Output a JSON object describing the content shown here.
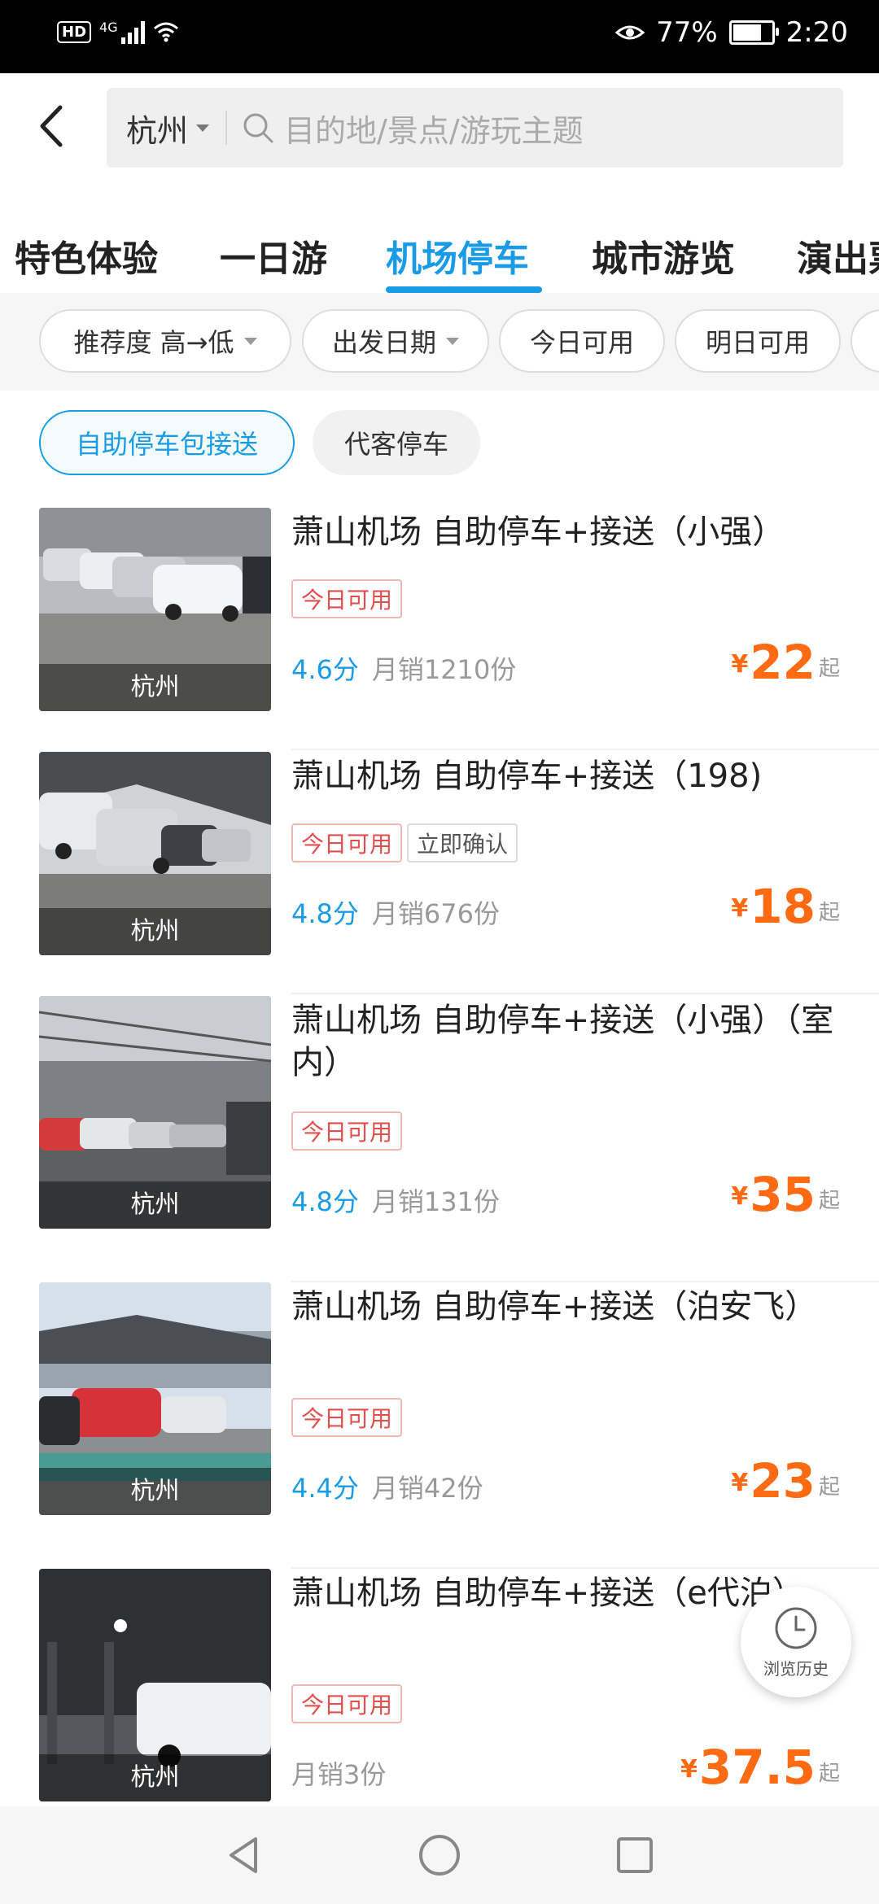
{
  "status_bar": {
    "hd": "HD",
    "network": "4G",
    "battery": "77%",
    "battery_level": 0.77,
    "time": "2:20"
  },
  "header": {
    "city": "杭州",
    "search_placeholder": "目的地/景点/游玩主题"
  },
  "tabs": [
    {
      "label": "特色体验",
      "active": false
    },
    {
      "label": "一日游",
      "active": false
    },
    {
      "label": "机场停车",
      "active": true
    },
    {
      "label": "城市游览",
      "active": false
    },
    {
      "label": "演出票",
      "active": false
    }
  ],
  "filters": [
    "推荐度 高→低",
    "出发日期",
    "今日可用",
    "明日可用"
  ],
  "sub_filters": [
    {
      "label": "自助停车包接送",
      "active": true
    },
    {
      "label": "代客停车",
      "active": false
    }
  ],
  "listings": [
    {
      "title": "萧山机场 自助停车+接送（小强）",
      "city": "杭州",
      "tags": [
        "今日可用"
      ],
      "score": "4.6分",
      "sales": "月销1210份",
      "price": "22",
      "price_suffix": "起"
    },
    {
      "title": "萧山机场 自助停车+接送（198)",
      "city": "杭州",
      "tags": [
        "今日可用",
        "立即确认"
      ],
      "score": "4.8分",
      "sales": "月销676份",
      "price": "18",
      "price_suffix": "起"
    },
    {
      "title": "萧山机场 自助停车+接送（小强）（室内）",
      "city": "杭州",
      "tags": [
        "今日可用"
      ],
      "score": "4.8分",
      "sales": "月销131份",
      "price": "35",
      "price_suffix": "起"
    },
    {
      "title": "萧山机场 自助停车+接送（泊安飞）",
      "city": "杭州",
      "tags": [
        "今日可用"
      ],
      "score": "4.4分",
      "sales": "月销42份",
      "price": "23",
      "price_suffix": "起"
    },
    {
      "title": "萧山机场 自助停车+接送（e代泊）",
      "city": "杭州",
      "tags": [
        "今日可用"
      ],
      "score": "",
      "sales": "月销3份",
      "price": "37.5",
      "price_suffix": "起"
    }
  ],
  "currency": "¥",
  "history_button": "浏览历史",
  "colors": {
    "accent": "#1a9be6",
    "price": "#ff6a12",
    "tag_red": "#e04e4e"
  }
}
